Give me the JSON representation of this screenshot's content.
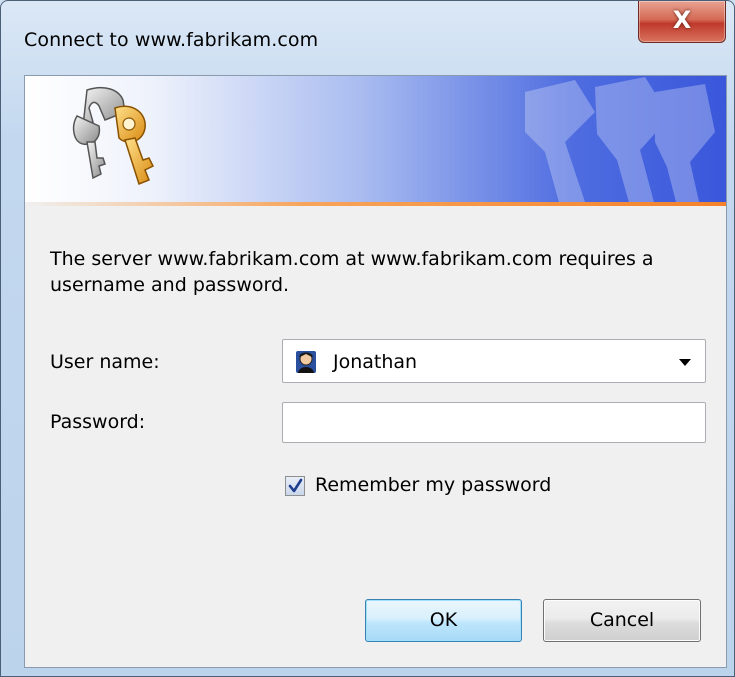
{
  "window": {
    "title": "Connect to www.fabrikam.com",
    "close_label": "X"
  },
  "banner": {
    "icon": "keys-icon",
    "accent_color": "#3a57db",
    "stripe_color": "#f4822a"
  },
  "message": "The server www.fabrikam.com at www.fabrikam.com requires a username and password.",
  "form": {
    "username_label": "User name:",
    "username_value": "Jonathan",
    "password_label": "Password:",
    "password_value": "",
    "remember_label": "Remember my password",
    "remember_checked": true
  },
  "buttons": {
    "ok_label": "OK",
    "cancel_label": "Cancel"
  }
}
